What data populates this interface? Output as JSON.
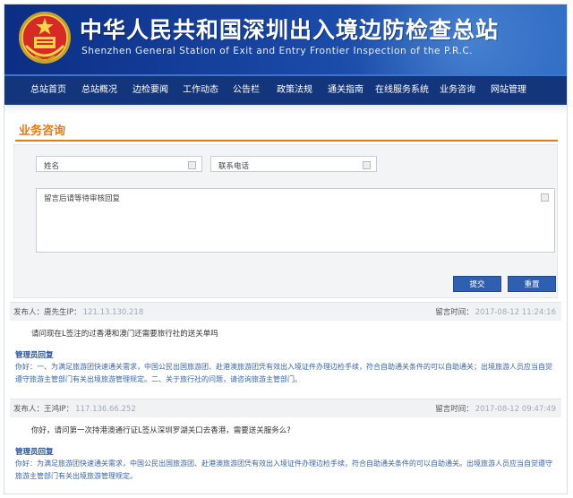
{
  "header": {
    "title_zh": "中华人民共和国深圳出入境边防检查总站",
    "title_en": "Shenzhen General Station of Exit and Entry Frontier Inspection of the P.R.C."
  },
  "nav": [
    {
      "label": "总站首页"
    },
    {
      "label": "总站概况"
    },
    {
      "label": "边检要闻"
    },
    {
      "label": "工作动态"
    },
    {
      "label": "公告栏"
    },
    {
      "label": "政策法规"
    },
    {
      "label": "通关指南"
    },
    {
      "label": "在线服务系统"
    },
    {
      "label": "业务咨询"
    },
    {
      "label": "网站管理"
    }
  ],
  "section": {
    "title": "业务咨询"
  },
  "form": {
    "name_placeholder": "姓名",
    "phone_placeholder": "联系电话",
    "message_placeholder": "留言后请等待审核回复",
    "submit_label": "提交",
    "reset_label": "重置"
  },
  "comments": [
    {
      "poster_label": "发布人：",
      "poster_name": "唐先生IP：",
      "poster_ip": "121.13.130.218",
      "time_label": "留言时间：",
      "time_value": "2017-08-12 11:24:16",
      "question": "请问现在L签注的过香港和澳门还需要旅行社的送关单吗",
      "admin_label": "管理员回复",
      "reply": "你好：一、为满足旅游团快速通关需求，中国公民出国旅游团、赴港澳旅游团凭有效出入境证件办理边检手续，符合自助通关条件的可以自助通关；出境旅游人员应当自觉遵守旅游主管部门有关出境旅游管理规定。二、关于旅行社的问题，请咨询旅游主管部门。"
    },
    {
      "poster_label": "发布人：",
      "poster_name": "王鸿IP：",
      "poster_ip": "117.136.66.252",
      "time_label": "留言时间：",
      "time_value": "2017-08-12 09:47:49",
      "question": "你好，请问第一次持港澳通行证L签从深圳罗湖关口去香港，需要送关服务么?",
      "admin_label": "管理员回复",
      "reply": "你好：为满足旅游团快速通关需求，中国公民出国旅游团、赴港澳旅游团凭有效出入境证件办理边检手续，符合自助通关条件的可以自助通关。出境旅游人员应当自觉遵守旅游主管部门有关出境旅游管理规定。"
    }
  ],
  "colors": {
    "header_blue": "#13357c",
    "accent_orange": "#e47a14",
    "reply_blue": "#3c64a4",
    "button_blue": "#2f5fb0"
  },
  "icons": {
    "emblem": "national-emblem-icon"
  }
}
